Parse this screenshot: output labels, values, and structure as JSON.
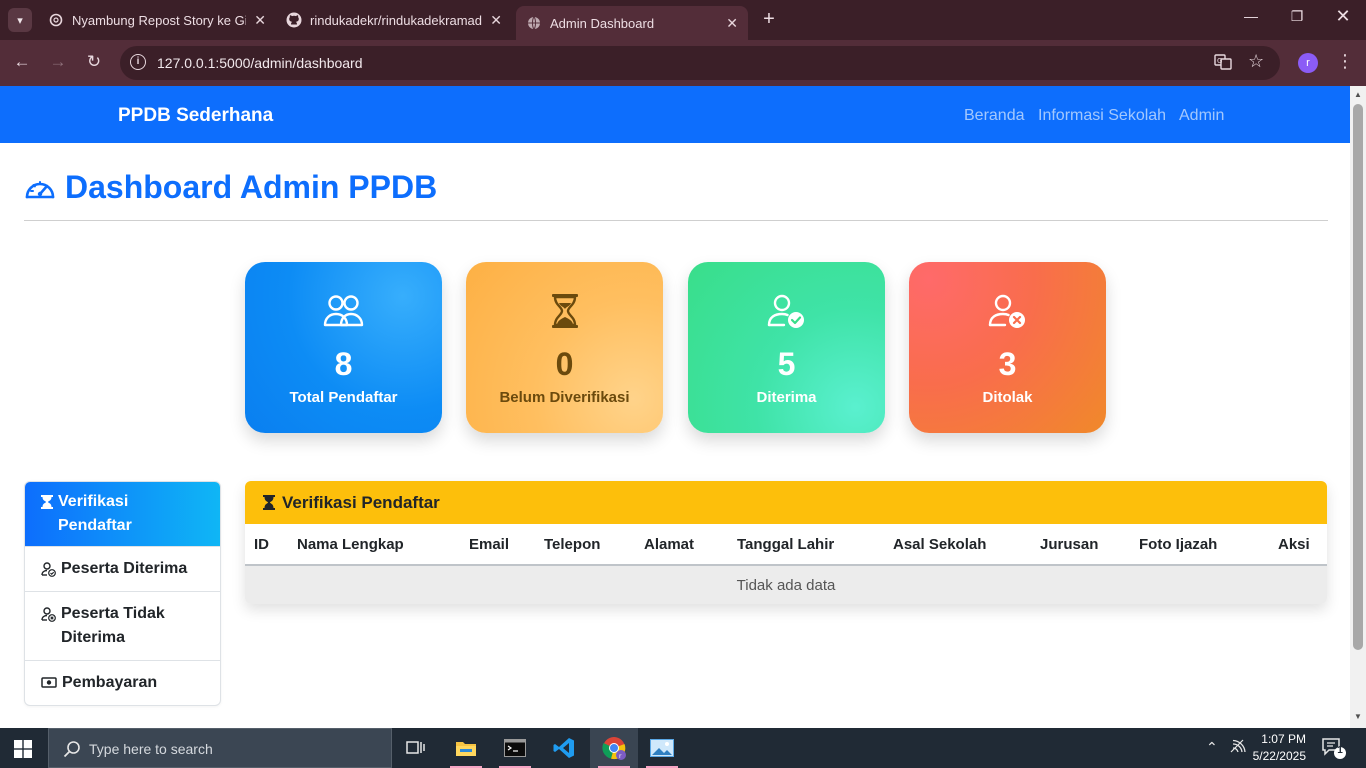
{
  "browser": {
    "tabs": [
      {
        "title": "Nyambung Repost Story ke GitHub",
        "active": false
      },
      {
        "title": "rindukadekr/rindukadekramadhani",
        "active": false
      },
      {
        "title": "Admin Dashboard",
        "active": true
      }
    ],
    "url": "127.0.0.1:5000/admin/dashboard",
    "profile_initial": "r"
  },
  "navbar": {
    "brand": "PPDB Sederhana",
    "links": [
      "Beranda",
      "Informasi Sekolah",
      "Admin"
    ]
  },
  "page": {
    "title": "Dashboard Admin PPDB"
  },
  "stats": [
    {
      "value": "8",
      "label": "Total Pendaftar",
      "icon": "people-icon",
      "color": "#0d8cf5"
    },
    {
      "value": "0",
      "label": "Belum Diverifikasi",
      "icon": "hourglass-icon",
      "color": "#fdb044"
    },
    {
      "value": "5",
      "label": "Diterima",
      "icon": "person-check-icon",
      "color": "#39de8a"
    },
    {
      "value": "3",
      "label": "Ditolak",
      "icon": "person-x-icon",
      "color": "#f96d4c"
    }
  ],
  "sidebar": {
    "items": [
      {
        "label": "Verifikasi Pendaftar",
        "icon": "hourglass-icon",
        "active": true
      },
      {
        "label": "Peserta Diterima",
        "icon": "person-check-icon",
        "active": false
      },
      {
        "label": "Peserta Tidak Diterima",
        "icon": "person-x-icon",
        "active": false
      },
      {
        "label": "Pembayaran",
        "icon": "cash-icon",
        "active": false
      }
    ]
  },
  "panel": {
    "title": "Verifikasi Pendaftar",
    "columns": [
      "ID",
      "Nama Lengkap",
      "Email",
      "Telepon",
      "Alamat",
      "Tanggal Lahir",
      "Asal Sekolah",
      "Jurusan",
      "Foto Ijazah",
      "Aksi"
    ],
    "empty_text": "Tidak ada data"
  },
  "taskbar": {
    "search_placeholder": "Type here to search",
    "time": "1:07 PM",
    "date": "5/22/2025",
    "notification_count": "1"
  },
  "colors": {
    "primary": "#0d6efd",
    "panel_header": "#fdbf0b",
    "browser_frame": "#532d39"
  }
}
